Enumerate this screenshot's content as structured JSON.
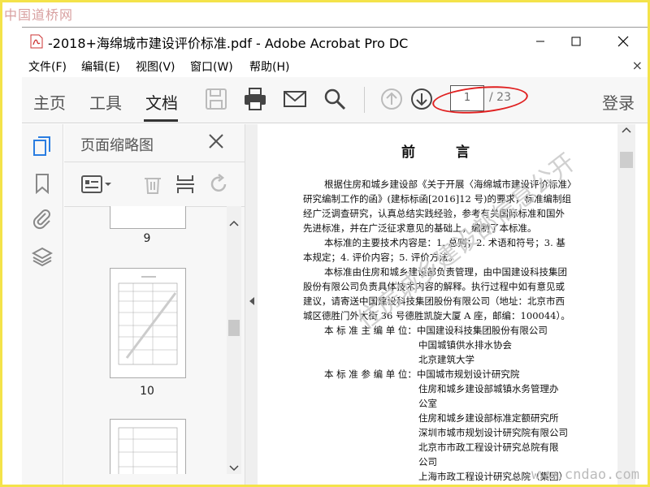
{
  "watermark_site": "中国道桥网",
  "window": {
    "title": "-2018+海绵城市建设评价标准.pdf - Adobe Acrobat Pro DC"
  },
  "menu": {
    "items": [
      "文件(F)",
      "编辑(E)",
      "视图(V)",
      "窗口(W)",
      "帮助(H)"
    ],
    "close": "×"
  },
  "toolbar": {
    "tabs": [
      "主页",
      "工具",
      "文档"
    ],
    "active_tab": "文档",
    "page_current": "1",
    "page_total": "/ 23",
    "login": "登录"
  },
  "thumbnails": {
    "title": "页面缩略图",
    "pages": [
      "9",
      "10"
    ]
  },
  "document": {
    "heading": "前 言",
    "lines": [
      "根据住房和城乡建设部《关于开展〈海绵城市建设评价标准〉",
      "研究编制工作的函》(建标标函[2016]12 号)的要求，标准编制组",
      "经广泛调查研究，认真总结实践经验，参考有关国际标准和国外",
      "先进标准，并在广泛征求意见的基础上，编制了本标准。",
      "本标准的主要技术内容是：1. 总则；2. 术语和符号；3. 基",
      "本规定；4. 评价内容；5. 评价方法。",
      "本标准由住房和城乡建设部负责管理，由中国建设科技集团",
      "股份有限公司负责具体技术内容的解释。执行过程中如有意见或",
      "建议，请寄送中国建设科技集团股份有限公司（地址：北京市西",
      "城区德胜门外大街 36 号德胜凯旋大厦 A 座，邮编：100044）。",
      "本 标 准 主 编 单 位：中国建设科技集团股份有限公司",
      "中国城镇供水排水协会",
      "北京建筑大学",
      "本 标 准 参 编 单 位：中国城市规划设计研究院",
      "住房和城乡建设部城镇水务管理办",
      "公室",
      "住房和城乡建设部标准定额研究所",
      "深圳市城市规划设计研究院有限公司",
      "北京市市政工程设计研究总院有限",
      "公司",
      "上海市政工程设计研究总院（集团）"
    ],
    "watermark": "住房城乡建设部信息公开"
  },
  "bottom_watermark": "www.cndao.com"
}
